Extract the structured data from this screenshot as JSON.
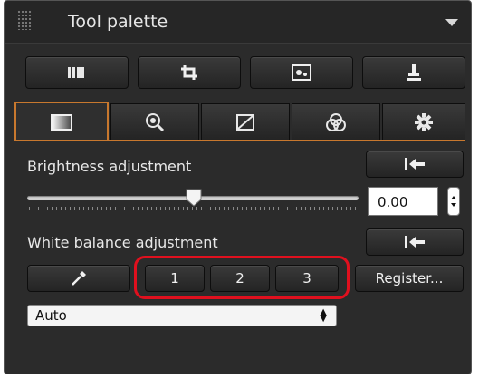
{
  "palette": {
    "title": "Tool palette"
  },
  "toolbar": {
    "buttons": [
      "compare-view",
      "crop",
      "dust-delete",
      "stamp"
    ]
  },
  "tabs": [
    {
      "name": "tab-basic-adjustment",
      "active": true
    },
    {
      "name": "tab-lens-correction",
      "active": false
    },
    {
      "name": "tab-tone-curve",
      "active": false
    },
    {
      "name": "tab-color-adjustment",
      "active": false
    },
    {
      "name": "tab-settings",
      "active": false
    }
  ],
  "brightness": {
    "label": "Brightness adjustment",
    "value": "0.00"
  },
  "white_balance": {
    "label": "White balance adjustment",
    "presets": [
      "1",
      "2",
      "3"
    ],
    "register_label": "Register...",
    "select_value": "Auto"
  },
  "colors": {
    "accent": "#c8782e",
    "highlight": "#e0101e",
    "panel": "#2b2b2b"
  }
}
